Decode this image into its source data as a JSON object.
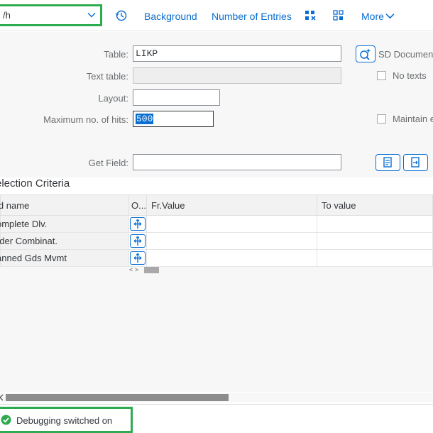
{
  "toolbar": {
    "command_value": "/h",
    "background_label": "Background",
    "number_entries_label": "Number of Entries",
    "more_label": "More"
  },
  "form": {
    "table_label": "Table:",
    "table_value": "LIKP",
    "table_description": "SD Documen",
    "text_table_label": "Text table:",
    "text_table_value": "",
    "no_texts_label": "No texts",
    "layout_label": "Layout:",
    "layout_value": "",
    "max_hits_label": "Maximum no. of hits:",
    "max_hits_value": "500",
    "maintain_label": "Maintain e",
    "get_field_label": "Get Field:",
    "get_field_value": ""
  },
  "selection": {
    "title": "election Criteria",
    "columns": [
      "ld name",
      "O...",
      "Fr.Value",
      "To value"
    ],
    "rows": [
      {
        "name": "omplete Dlv.",
        "from": "",
        "to": ""
      },
      {
        "name": "rder Combinat.",
        "from": "",
        "to": ""
      },
      {
        "name": "anned Gds Mvmt",
        "from": "",
        "to": ""
      }
    ],
    "scroll_arrows": "< >"
  },
  "status": {
    "message": "Debugging switched on",
    "color": "#2eaa4f"
  },
  "icons": {
    "history": "history-icon",
    "command_dropdown": "chevron-down-icon",
    "more_dropdown": "chevron-down-icon",
    "check_table": "table-search-icon",
    "get_field_1": "document-insert-icon",
    "get_field_2": "document-transfer-icon",
    "operator": "selection-option-icon",
    "status": "success-icon"
  },
  "colors": {
    "accent": "#0a6ed1",
    "highlight_frame": "#2eaa4f",
    "form_background": "#f7f7f7"
  }
}
